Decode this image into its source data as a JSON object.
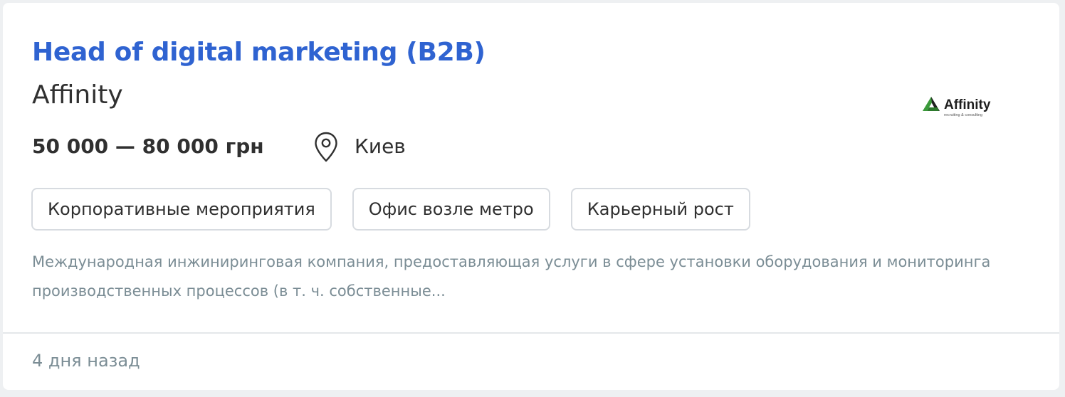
{
  "vacancy": {
    "title": "Head of digital marketing (B2B)",
    "company": "Affinity",
    "salary": "50 000 — 80 000 грн",
    "location": {
      "icon": "location-pin-icon",
      "city": "Киев"
    },
    "logo": {
      "name": "Affinity",
      "tagline": "recruiting & consulting",
      "colors": {
        "green": "#3a9a3a",
        "dark": "#1f1f1f"
      }
    },
    "tags": [
      "Корпоративные мероприятия",
      "Офис возле метро",
      "Карьерный рост"
    ],
    "description": "Международная инжиниринговая компания, предоставляющая услуги в сфере установки оборудования и мониторинга производственных процессов (в т. ч. собственные...",
    "posted": "4 дня назад"
  },
  "colors": {
    "title": "#2f63d1",
    "text": "#303030",
    "muted": "#7b8d95",
    "border": "#d7dbe0",
    "background": "#eef0f2"
  }
}
